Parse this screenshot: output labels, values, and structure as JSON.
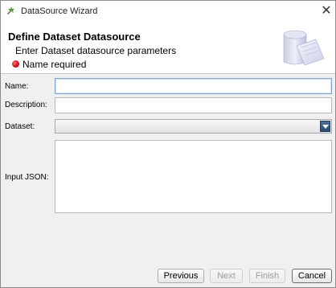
{
  "window": {
    "title": "DataSource Wizard",
    "close_glyph": "✕"
  },
  "header": {
    "title": "Define Dataset Datasource",
    "subtitle": "Enter Dataset datasource parameters",
    "error_message": "Name required",
    "error_icon": "error-dot-icon",
    "graphic_icon": "datasource-cylinder-icon"
  },
  "form": {
    "name": {
      "label": "Name:",
      "value": ""
    },
    "description": {
      "label": "Description:",
      "value": ""
    },
    "dataset": {
      "label": "Dataset:",
      "selected": ""
    },
    "input_json": {
      "label": "Input JSON:",
      "value": ""
    }
  },
  "buttons": {
    "previous": "Previous",
    "next": "Next",
    "finish": "Finish",
    "cancel": "Cancel"
  },
  "colors": {
    "error": "#c00000",
    "combo_arrow": "#3a5a82"
  }
}
